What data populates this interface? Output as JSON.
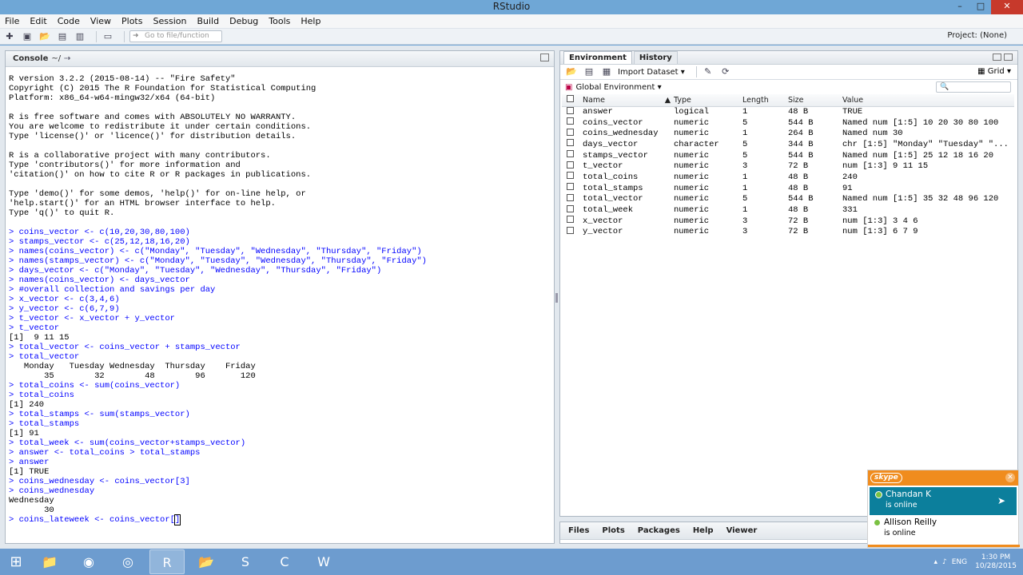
{
  "window": {
    "title": "RStudio",
    "minimize": "–",
    "maximize": "□",
    "close": "✕"
  },
  "menu": [
    "File",
    "Edit",
    "Code",
    "View",
    "Plots",
    "Session",
    "Build",
    "Debug",
    "Tools",
    "Help"
  ],
  "toolbar": {
    "goto_placeholder": "Go to file/function",
    "project": "Project: (None)"
  },
  "console": {
    "title": "Console",
    "path": "~/",
    "lines": [
      {
        "t": "R version 3.2.2 (2015-08-14) -- \"Fire Safety\"",
        "c": "out"
      },
      {
        "t": "Copyright (C) 2015 The R Foundation for Statistical Computing",
        "c": "out"
      },
      {
        "t": "Platform: x86_64-w64-mingw32/x64 (64-bit)",
        "c": "out"
      },
      {
        "t": "",
        "c": "gap"
      },
      {
        "t": "R is free software and comes with ABSOLUTELY NO WARRANTY.",
        "c": "out"
      },
      {
        "t": "You are welcome to redistribute it under certain conditions.",
        "c": "out"
      },
      {
        "t": "Type 'license()' or 'licence()' for distribution details.",
        "c": "out"
      },
      {
        "t": "",
        "c": "gap"
      },
      {
        "t": "R is a collaborative project with many contributors.",
        "c": "out"
      },
      {
        "t": "Type 'contributors()' for more information and",
        "c": "out"
      },
      {
        "t": "'citation()' on how to cite R or R packages in publications.",
        "c": "out"
      },
      {
        "t": "",
        "c": "gap"
      },
      {
        "t": "Type 'demo()' for some demos, 'help()' for on-line help, or",
        "c": "out"
      },
      {
        "t": "'help.start()' for an HTML browser interface to help.",
        "c": "out"
      },
      {
        "t": "Type 'q()' to quit R.",
        "c": "out"
      },
      {
        "t": "",
        "c": "gap"
      },
      {
        "t": "> coins_vector <- c(10,20,30,80,100)",
        "c": "cmd"
      },
      {
        "t": "> stamps_vector <- c(25,12,18,16,20)",
        "c": "cmd"
      },
      {
        "t": "> names(coins_vector) <- c(\"Monday\", \"Tuesday\", \"Wednesday\", \"Thursday\", \"Friday\")",
        "c": "cmd"
      },
      {
        "t": "> names(stamps_vector) <- c(\"Monday\", \"Tuesday\", \"Wednesday\", \"Thursday\", \"Friday\")",
        "c": "cmd"
      },
      {
        "t": "> days_vector <- c(\"Monday\", \"Tuesday\", \"Wednesday\", \"Thursday\", \"Friday\")",
        "c": "cmd"
      },
      {
        "t": "> names(coins_vector) <- days_vector",
        "c": "cmd"
      },
      {
        "t": "> #overall collection and savings per day",
        "c": "cmd"
      },
      {
        "t": "> x_vector <- c(3,4,6)",
        "c": "cmd"
      },
      {
        "t": "> y_vector <- c(6,7,9)",
        "c": "cmd"
      },
      {
        "t": "> t_vector <- x_vector + y_vector",
        "c": "cmd"
      },
      {
        "t": "> t_vector",
        "c": "cmd"
      },
      {
        "t": "[1]  9 11 15",
        "c": "out"
      },
      {
        "t": "> total_vector <- coins_vector + stamps_vector",
        "c": "cmd"
      },
      {
        "t": "> total_vector",
        "c": "cmd"
      },
      {
        "t": "   Monday   Tuesday Wednesday  Thursday    Friday",
        "c": "out"
      },
      {
        "t": "       35        32        48        96       120",
        "c": "out"
      },
      {
        "t": "> total_coins <- sum(coins_vector)",
        "c": "cmd"
      },
      {
        "t": "> total_coins",
        "c": "cmd"
      },
      {
        "t": "[1] 240",
        "c": "out"
      },
      {
        "t": "> total_stamps <- sum(stamps_vector)",
        "c": "cmd"
      },
      {
        "t": "> total_stamps",
        "c": "cmd"
      },
      {
        "t": "[1] 91",
        "c": "out"
      },
      {
        "t": "> total_week <- sum(coins_vector+stamps_vector)",
        "c": "cmd"
      },
      {
        "t": "> answer <- total_coins > total_stamps",
        "c": "cmd"
      },
      {
        "t": "> answer",
        "c": "cmd"
      },
      {
        "t": "[1] TRUE",
        "c": "out"
      },
      {
        "t": "> coins_wednesday <- coins_vector[3]",
        "c": "cmd"
      },
      {
        "t": "> coins_wednesday",
        "c": "cmd"
      },
      {
        "t": "Wednesday",
        "c": "out"
      },
      {
        "t": "       30",
        "c": "out"
      }
    ],
    "current_input": "> coins_lateweek <- coins_vector[",
    "current_input_after": "]"
  },
  "env": {
    "tabs": [
      "Environment",
      "History"
    ],
    "import_label": "Import Dataset",
    "grid_label": "Grid",
    "global_env": "Global Environment",
    "search_glyph": "🔍",
    "columns": [
      "Name",
      "Type",
      "Length",
      "Size",
      "Value"
    ],
    "rows": [
      {
        "name": "answer",
        "type": "logical",
        "length": "1",
        "size": "48 B",
        "value": "TRUE"
      },
      {
        "name": "coins_vector",
        "type": "numeric",
        "length": "5",
        "size": "544 B",
        "value": "Named num [1:5] 10 20 30 80 100"
      },
      {
        "name": "coins_wednesday",
        "type": "numeric",
        "length": "1",
        "size": "264 B",
        "value": "Named num 30"
      },
      {
        "name": "days_vector",
        "type": "character",
        "length": "5",
        "size": "344 B",
        "value": "chr [1:5] \"Monday\" \"Tuesday\" \"..."
      },
      {
        "name": "stamps_vector",
        "type": "numeric",
        "length": "5",
        "size": "544 B",
        "value": "Named num [1:5] 25 12 18 16 20"
      },
      {
        "name": "t_vector",
        "type": "numeric",
        "length": "3",
        "size": "72 B",
        "value": "num [1:3] 9 11 15"
      },
      {
        "name": "total_coins",
        "type": "numeric",
        "length": "1",
        "size": "48 B",
        "value": "240"
      },
      {
        "name": "total_stamps",
        "type": "numeric",
        "length": "1",
        "size": "48 B",
        "value": "91"
      },
      {
        "name": "total_vector",
        "type": "numeric",
        "length": "5",
        "size": "544 B",
        "value": "Named num [1:5] 35 32 48 96 120"
      },
      {
        "name": "total_week",
        "type": "numeric",
        "length": "1",
        "size": "48 B",
        "value": "331"
      },
      {
        "name": "x_vector",
        "type": "numeric",
        "length": "3",
        "size": "72 B",
        "value": "num [1:3] 3 4 6"
      },
      {
        "name": "y_vector",
        "type": "numeric",
        "length": "3",
        "size": "72 B",
        "value": "num [1:3] 6 7 9"
      }
    ]
  },
  "files_tabs": [
    "Files",
    "Plots",
    "Packages",
    "Help",
    "Viewer"
  ],
  "skype": {
    "logo": "skype",
    "contacts": [
      {
        "name": "Chandan K",
        "status": "is online"
      },
      {
        "name": "Allison Reilly",
        "status": "is online"
      }
    ]
  },
  "taskbar": {
    "apps": [
      "📁",
      "◉",
      "◎",
      "R",
      "📂",
      "S",
      "C",
      "W"
    ],
    "lang": "ENG",
    "time": "1:30 PM",
    "date": "10/28/2015"
  },
  "colors": {
    "accent": "#6fa7d6",
    "skype_orange": "#f08c1e",
    "skype_selected": "#0c7f9c",
    "console_cmd": "#0000ff"
  }
}
